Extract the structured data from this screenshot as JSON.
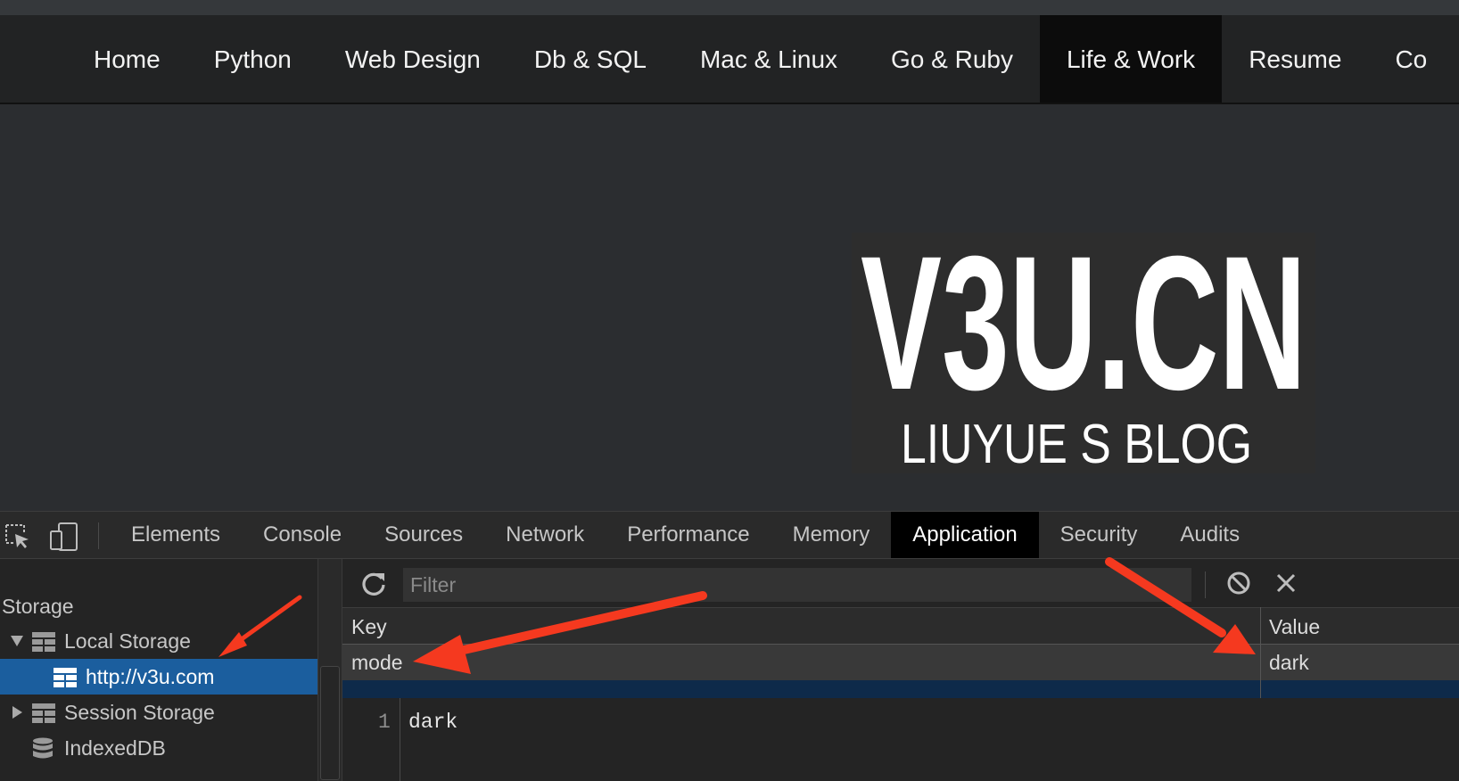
{
  "navbar": {
    "items": [
      {
        "label": "Home"
      },
      {
        "label": "Python"
      },
      {
        "label": "Web Design"
      },
      {
        "label": "Db & SQL"
      },
      {
        "label": "Mac & Linux"
      },
      {
        "label": "Go & Ruby"
      },
      {
        "label": "Life & Work",
        "active": true
      },
      {
        "label": "Resume"
      },
      {
        "label": "Co"
      }
    ]
  },
  "hero": {
    "logo_title": "V3U.CN",
    "logo_subtitle": "LIUYUE S BLOG"
  },
  "devtools": {
    "tabs": [
      "Elements",
      "Console",
      "Sources",
      "Network",
      "Performance",
      "Memory",
      "Application",
      "Security",
      "Audits"
    ],
    "active_tab": "Application",
    "sidebar": {
      "section_title": "Storage",
      "items": [
        {
          "label": "Local Storage",
          "icon": "table-icon",
          "expanded": true
        },
        {
          "label": "http://v3u.com",
          "icon": "table-icon",
          "selected": true
        },
        {
          "label": "Session Storage",
          "icon": "table-icon",
          "expanded": false
        },
        {
          "label": "IndexedDB",
          "icon": "database-icon"
        }
      ]
    },
    "toolbar": {
      "filter_placeholder": "Filter"
    },
    "table": {
      "columns": [
        "Key",
        "Value"
      ],
      "rows": [
        {
          "key": "mode",
          "value": "dark"
        }
      ]
    },
    "preview": {
      "line_number": "1",
      "text": "dark"
    }
  },
  "colors": {
    "accent_selected": "#1b5e9e",
    "annotation_arrow": "#f5391f",
    "navbar_bg": "#222324",
    "page_bg": "#2b2d30"
  }
}
